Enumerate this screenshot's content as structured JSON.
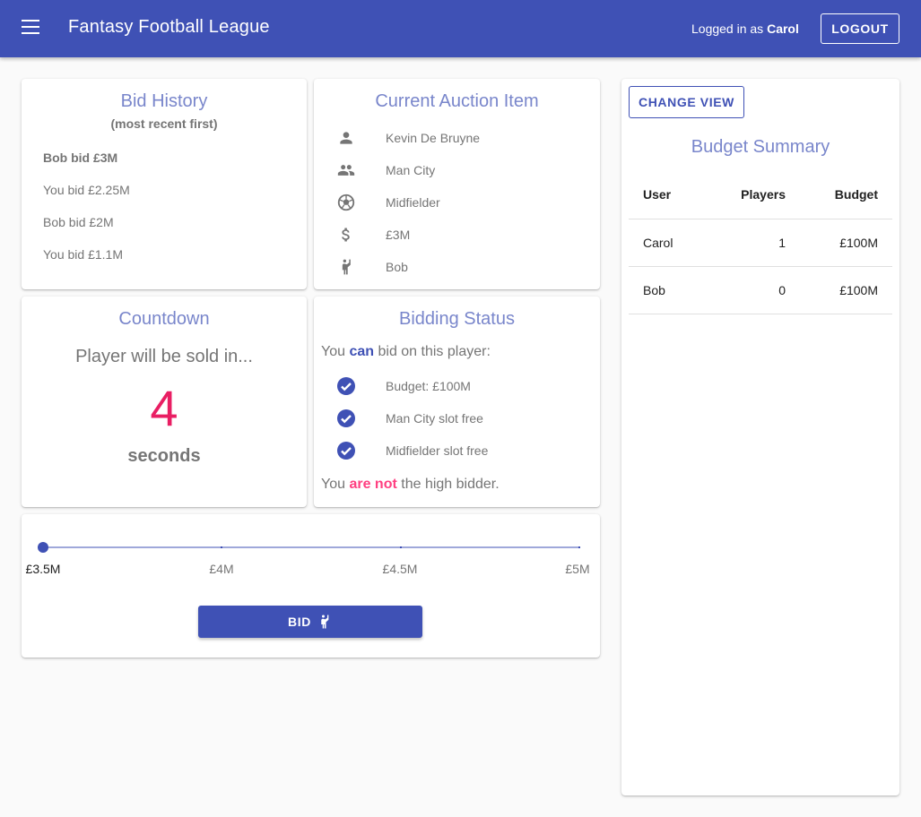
{
  "header": {
    "title": "Fantasy Football League",
    "logged_in_prefix": "Logged in as",
    "username": "Carol",
    "logout_label": "LOGOUT"
  },
  "bid_history": {
    "title": "Bid History",
    "subtitle": "(most recent first)",
    "entries": [
      "Bob bid £3M",
      "You bid £2.25M",
      "Bob bid £2M",
      "You bid £1.1M"
    ]
  },
  "auction_item": {
    "title": "Current Auction Item",
    "rows": [
      {
        "icon": "person-icon",
        "text": "Kevin De Bruyne"
      },
      {
        "icon": "group-icon",
        "text": "Man City"
      },
      {
        "icon": "soccer-ball-icon",
        "text": "Midfielder"
      },
      {
        "icon": "dollar-icon",
        "text": "£3M"
      },
      {
        "icon": "hand-raised-icon",
        "text": "Bob"
      }
    ]
  },
  "countdown": {
    "title": "Countdown",
    "prefix": "Player will be sold in...",
    "value": "4",
    "suffix": "seconds"
  },
  "bidding_status": {
    "title": "Bidding Status",
    "line1_a": "You",
    "line1_b": "can",
    "line1_c": "bid on this player:",
    "checks": [
      "Budget: £100M",
      "Man City slot free",
      "Midfielder slot free"
    ],
    "line2_a": "You",
    "line2_b": "are not",
    "line2_c": "the high bidder."
  },
  "bid_slider": {
    "labels": [
      "£3.5M",
      "£4M",
      "£4.5M",
      "£5M"
    ],
    "selected": "£3.5M",
    "bid_label": "BID"
  },
  "budget_summary": {
    "change_view_label": "CHANGE VIEW",
    "title": "Budget Summary",
    "columns": [
      "User",
      "Players",
      "Budget"
    ],
    "rows": [
      {
        "user": "Carol",
        "players": "1",
        "budget": "£100M"
      },
      {
        "user": "Bob",
        "players": "0",
        "budget": "£100M"
      }
    ]
  },
  "colors": {
    "primary": "#3f51b5",
    "primary_light": "#7986cb",
    "accent": "#ff4081",
    "countdown": "#e91e63"
  }
}
